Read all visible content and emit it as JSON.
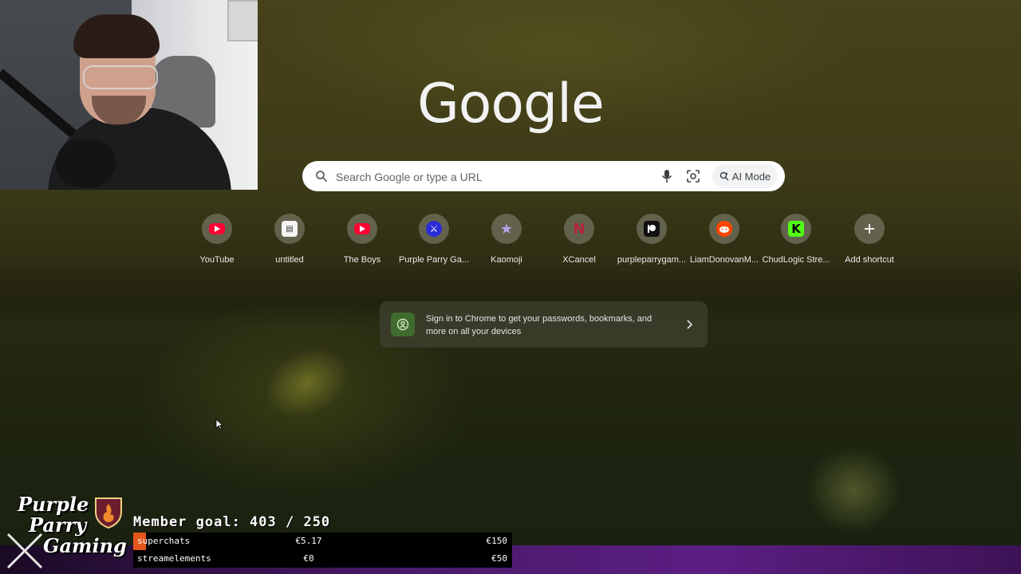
{
  "browser": {
    "logo_text": "Google",
    "search": {
      "placeholder": "Search Google or type a URL",
      "ai_mode_label": "AI Mode"
    },
    "shortcuts": [
      {
        "label": "YouTube",
        "icon": "youtube-icon"
      },
      {
        "label": "untitled",
        "icon": "document-icon"
      },
      {
        "label": "The Boys",
        "icon": "youtube-icon"
      },
      {
        "label": "Purple Parry Ga...",
        "icon": "purple-parry-icon"
      },
      {
        "label": "Kaomoji",
        "icon": "star-icon"
      },
      {
        "label": "XCancel",
        "icon": "n-letter-icon"
      },
      {
        "label": "purpleparrygam...",
        "icon": "patreon-icon"
      },
      {
        "label": "LiamDonovanM...",
        "icon": "reddit-icon"
      },
      {
        "label": "ChudLogic Stre...",
        "icon": "kick-icon"
      },
      {
        "label": "Add shortcut",
        "icon": "plus-icon"
      }
    ],
    "signin_card": {
      "text": "Sign in to Chrome to get your passwords, bookmarks, and more on all your devices"
    },
    "colors": {
      "youtube_red": "#ff0033",
      "kick_green": "#53fc18",
      "reddit_orange": "#ff4500"
    }
  },
  "stream_overlay": {
    "channel_logo": {
      "line1": "Purple",
      "line2": "Parry",
      "line3": "Gaming"
    },
    "member_goal": "Member goal: 403 / 250",
    "donations": [
      {
        "name": "superchats",
        "current": "€5.17",
        "goal": "€150",
        "progress": 0.034
      },
      {
        "name": "streamelements",
        "current": "€0",
        "goal": "€50",
        "progress": 0.0
      }
    ],
    "colors": {
      "progress_fill": "#e3561c",
      "bar_purple": "#5b1e82"
    }
  }
}
